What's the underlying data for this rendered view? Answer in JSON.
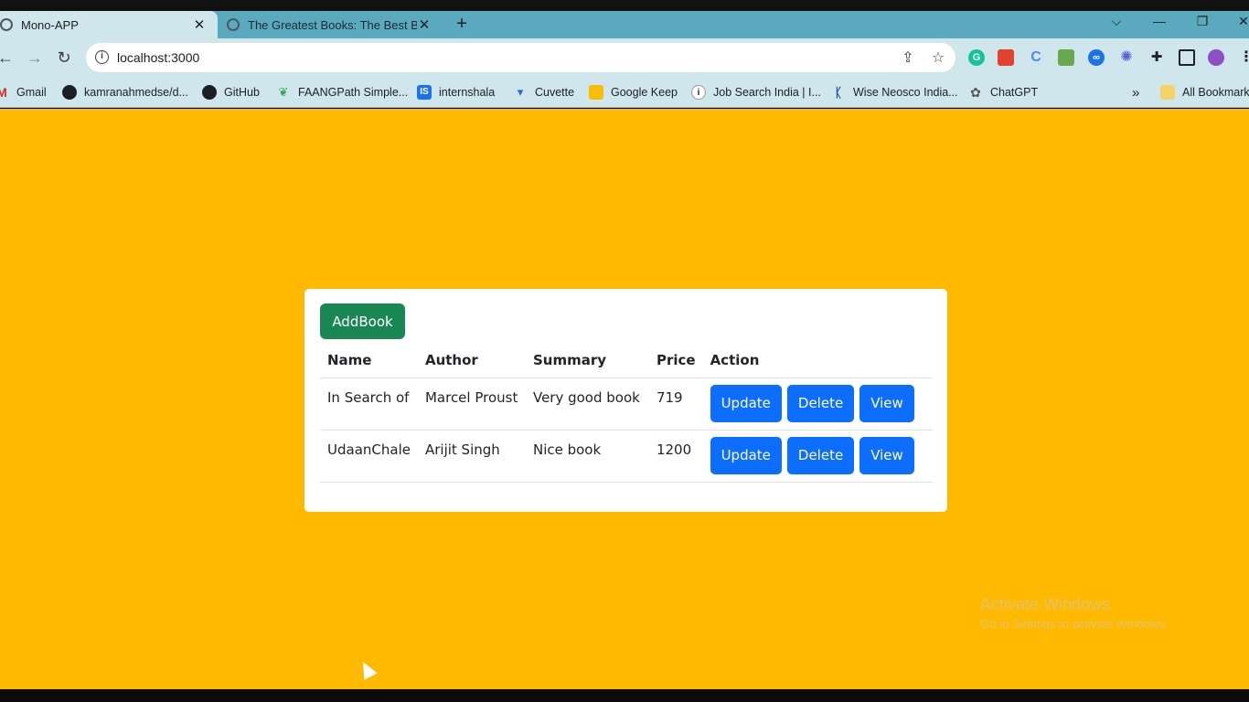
{
  "browser": {
    "tabs": [
      {
        "title": "Mono-APP",
        "close": "✕"
      },
      {
        "title": "The Greatest Books: The Best Bo",
        "close": "✕"
      }
    ],
    "new_tab": "+",
    "window_controls": {
      "dropdown": "⌵",
      "minimize": "—",
      "restore": "❐",
      "close": "✕"
    },
    "address": "localhost:3000",
    "bookmarks": [
      {
        "label": "Gmail",
        "icon": "gmail-icon"
      },
      {
        "label": "kamranahmedse/d...",
        "icon": "github-icon"
      },
      {
        "label": "GitHub",
        "icon": "github-icon"
      },
      {
        "label": "FAANGPath Simple...",
        "icon": "faangpath-icon"
      },
      {
        "label": "internshala",
        "icon": "internshala-icon"
      },
      {
        "label": "Cuvette",
        "icon": "cuvette-icon"
      },
      {
        "label": "Google Keep",
        "icon": "keep-icon"
      },
      {
        "label": "Job Search India | I...",
        "icon": "info-icon"
      },
      {
        "label": "Wise Neosco India...",
        "icon": "neosco-icon"
      },
      {
        "label": "ChatGPT",
        "icon": "chatgpt-icon"
      }
    ],
    "more_bookmarks": "»",
    "all_bookmarks": "All Bookmarks"
  },
  "page": {
    "add_button": "AddBook",
    "table": {
      "headers": [
        "Name",
        "Author",
        "Summary",
        "Price",
        "Action"
      ],
      "rows": [
        {
          "name": "In Search of",
          "author": "Marcel Proust",
          "summary": "Very good book",
          "price": "719"
        },
        {
          "name": "UdaanChale",
          "author": "Arijit Singh",
          "summary": "Nice book",
          "price": "1200"
        }
      ],
      "actions": {
        "update": "Update",
        "delete": "Delete",
        "view": "View"
      }
    }
  },
  "watermark": {
    "line1": "Activate Windows",
    "line2": "Go to Settings to activate Windows."
  },
  "colors": {
    "page_bg": "#ffba00",
    "add_button": "#198754",
    "action_buttons": "#0d6efd",
    "browser_frame": "#5ba9be"
  }
}
